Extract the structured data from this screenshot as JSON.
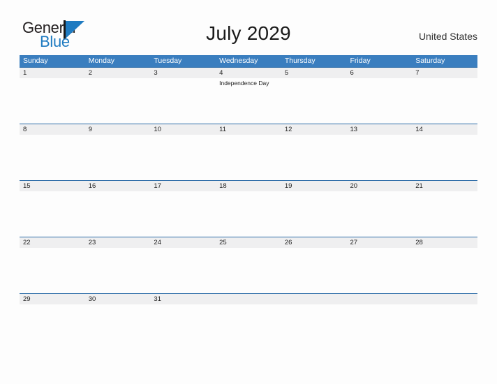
{
  "brand": {
    "name_part1": "General",
    "name_part2": "Blue",
    "mark": "triangle-logo-mark"
  },
  "header": {
    "title": "July 2029",
    "region": "United States"
  },
  "calendar": {
    "weekdays": [
      "Sunday",
      "Monday",
      "Tuesday",
      "Wednesday",
      "Thursday",
      "Friday",
      "Saturday"
    ],
    "accent_color": "#3a7ebf",
    "row_line_color": "#2d6ca8",
    "band_color": "#efeff0",
    "weeks": [
      [
        {
          "day": "1",
          "event": ""
        },
        {
          "day": "2",
          "event": ""
        },
        {
          "day": "3",
          "event": ""
        },
        {
          "day": "4",
          "event": "Independence Day"
        },
        {
          "day": "5",
          "event": ""
        },
        {
          "day": "6",
          "event": ""
        },
        {
          "day": "7",
          "event": ""
        }
      ],
      [
        {
          "day": "8",
          "event": ""
        },
        {
          "day": "9",
          "event": ""
        },
        {
          "day": "10",
          "event": ""
        },
        {
          "day": "11",
          "event": ""
        },
        {
          "day": "12",
          "event": ""
        },
        {
          "day": "13",
          "event": ""
        },
        {
          "day": "14",
          "event": ""
        }
      ],
      [
        {
          "day": "15",
          "event": ""
        },
        {
          "day": "16",
          "event": ""
        },
        {
          "day": "17",
          "event": ""
        },
        {
          "day": "18",
          "event": ""
        },
        {
          "day": "19",
          "event": ""
        },
        {
          "day": "20",
          "event": ""
        },
        {
          "day": "21",
          "event": ""
        }
      ],
      [
        {
          "day": "22",
          "event": ""
        },
        {
          "day": "23",
          "event": ""
        },
        {
          "day": "24",
          "event": ""
        },
        {
          "day": "25",
          "event": ""
        },
        {
          "day": "26",
          "event": ""
        },
        {
          "day": "27",
          "event": ""
        },
        {
          "day": "28",
          "event": ""
        }
      ],
      [
        {
          "day": "29",
          "event": ""
        },
        {
          "day": "30",
          "event": ""
        },
        {
          "day": "31",
          "event": ""
        },
        {
          "day": "",
          "event": ""
        },
        {
          "day": "",
          "event": ""
        },
        {
          "day": "",
          "event": ""
        },
        {
          "day": "",
          "event": ""
        }
      ]
    ]
  }
}
